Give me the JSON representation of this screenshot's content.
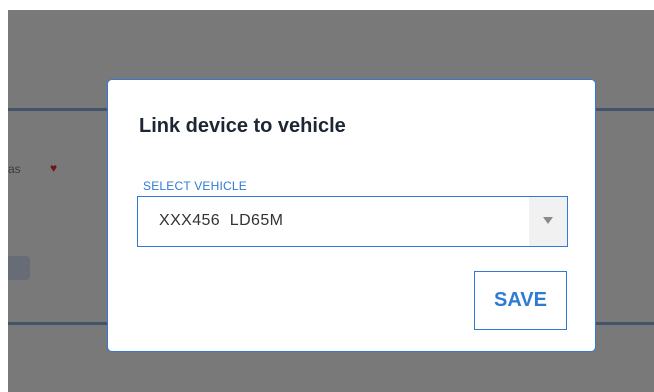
{
  "background": {
    "partial_text": "as",
    "heart_glyph": "♥"
  },
  "dialog": {
    "title": "Link device to vehicle",
    "field_label": "SELECT VEHICLE",
    "selected_vehicle": "XXX456  LD65M",
    "save_label": "SAVE"
  },
  "colors": {
    "accent": "#2f7bd4",
    "title": "#1d2733",
    "overlay": "rgba(0,0,0,0.5)"
  },
  "icons": {
    "select_arrow": "chevron-down-icon"
  }
}
